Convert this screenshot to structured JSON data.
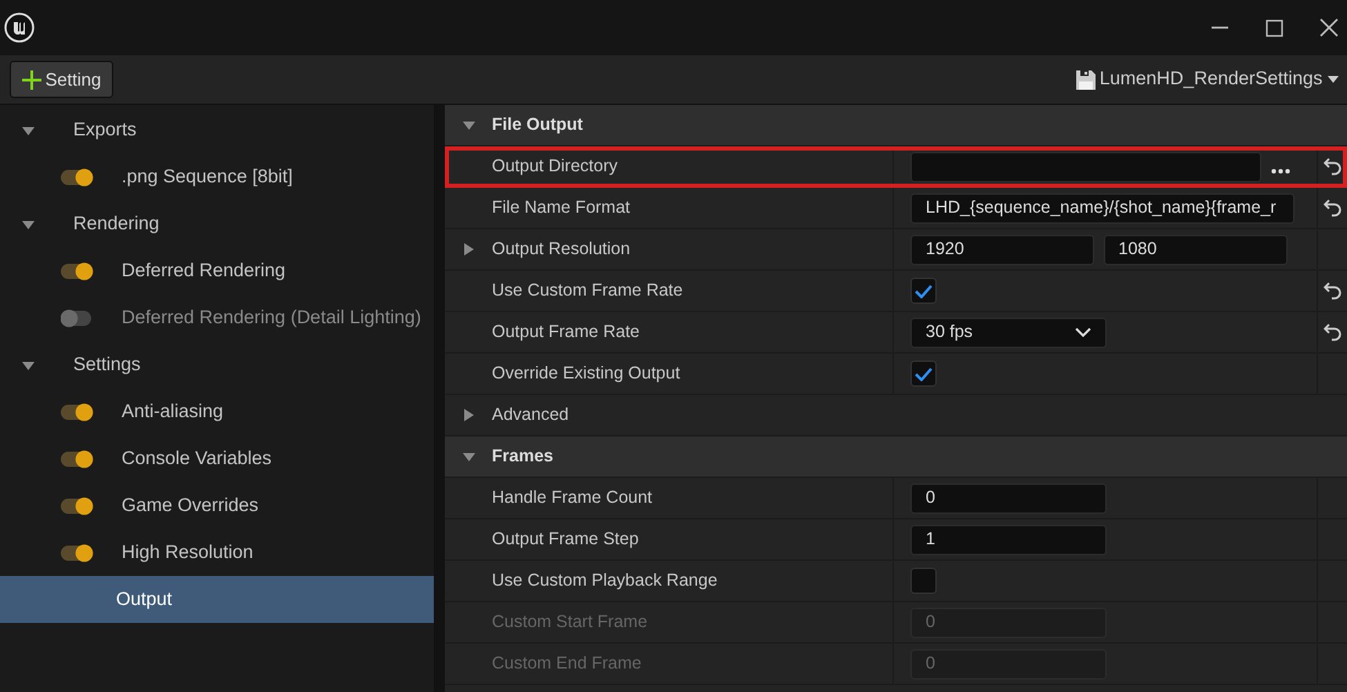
{
  "toolbar": {
    "add_button": "Setting",
    "preset": "LumenHD_RenderSettings"
  },
  "sidebar": {
    "items": [
      {
        "kind": "group",
        "label": "Exports",
        "expanded": true,
        "selected": false,
        "children": [
          {
            "kind": "toggle",
            "label": ".png Sequence [8bit]",
            "on": true,
            "selected": false
          }
        ]
      },
      {
        "kind": "group",
        "label": "Rendering",
        "expanded": true,
        "selected": false,
        "children": [
          {
            "kind": "toggle",
            "label": "Deferred Rendering",
            "on": true,
            "selected": false
          },
          {
            "kind": "toggle",
            "label": "Deferred Rendering (Detail Lighting)",
            "on": false,
            "selected": false
          }
        ]
      },
      {
        "kind": "group",
        "label": "Settings",
        "expanded": true,
        "selected": false,
        "children": [
          {
            "kind": "toggle",
            "label": "Anti-aliasing",
            "on": true,
            "selected": false
          },
          {
            "kind": "toggle",
            "label": "Console Variables",
            "on": true,
            "selected": false
          },
          {
            "kind": "toggle",
            "label": "Game Overrides",
            "on": true,
            "selected": false
          },
          {
            "kind": "toggle",
            "label": "High Resolution",
            "on": true,
            "selected": false
          },
          {
            "kind": "plain",
            "label": "Output",
            "selected": true
          }
        ]
      }
    ]
  },
  "properties": {
    "rows": [
      {
        "kind": "header",
        "label": "File Output",
        "expanded": true
      },
      {
        "kind": "path",
        "label": "Output Directory",
        "highlighted": true,
        "reset": true
      },
      {
        "kind": "text",
        "label": "File Name Format",
        "value": "LHD_{sequence_name}/{shot_name}{frame_r",
        "reset": true
      },
      {
        "kind": "pair",
        "label": "Output Resolution",
        "expanded": false,
        "values": [
          "1920",
          "1080"
        ]
      },
      {
        "kind": "checkbox",
        "label": "Use Custom Frame Rate",
        "checked": true,
        "reset": true
      },
      {
        "kind": "dropdown",
        "label": "Output Frame Rate",
        "value": "30 fps",
        "reset": true
      },
      {
        "kind": "checkbox",
        "label": "Override Existing Output",
        "checked": true
      },
      {
        "kind": "group",
        "label": "Advanced",
        "expanded": false
      },
      {
        "kind": "header",
        "label": "Frames",
        "expanded": true
      },
      {
        "kind": "number",
        "label": "Handle Frame Count",
        "value": "0"
      },
      {
        "kind": "number",
        "label": "Output Frame Step",
        "value": "1"
      },
      {
        "kind": "checkbox",
        "label": "Use Custom Playback Range",
        "checked": false
      },
      {
        "kind": "number",
        "label": "Custom Start Frame",
        "value": "0",
        "disabled": true
      },
      {
        "kind": "number",
        "label": "Custom End Frame",
        "value": "0",
        "disabled": true
      }
    ]
  }
}
